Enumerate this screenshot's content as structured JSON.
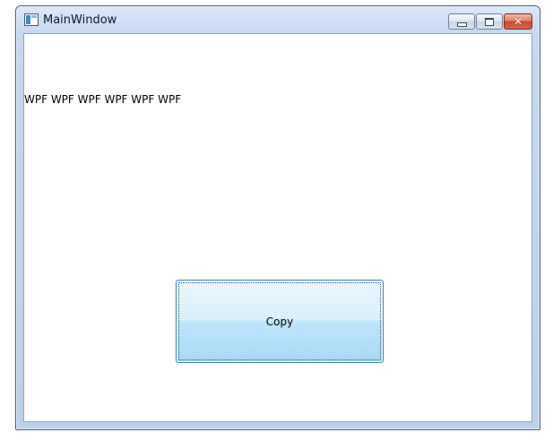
{
  "window": {
    "title": "MainWindow",
    "icon": "app-window-icon",
    "controls": {
      "minimize_icon": "minimize-icon",
      "maximize_icon": "maximize-icon",
      "close_icon": "close-icon",
      "close_glyph": "✕"
    }
  },
  "content": {
    "label_text": "WPF WPF WPF WPF WPF WPF",
    "copy_button_label": "Copy"
  },
  "colors": {
    "titlebar": "#c7d9ef",
    "close_button": "#c74a30",
    "button_face": "#bee6fd",
    "button_border": "#3c7fb1"
  }
}
